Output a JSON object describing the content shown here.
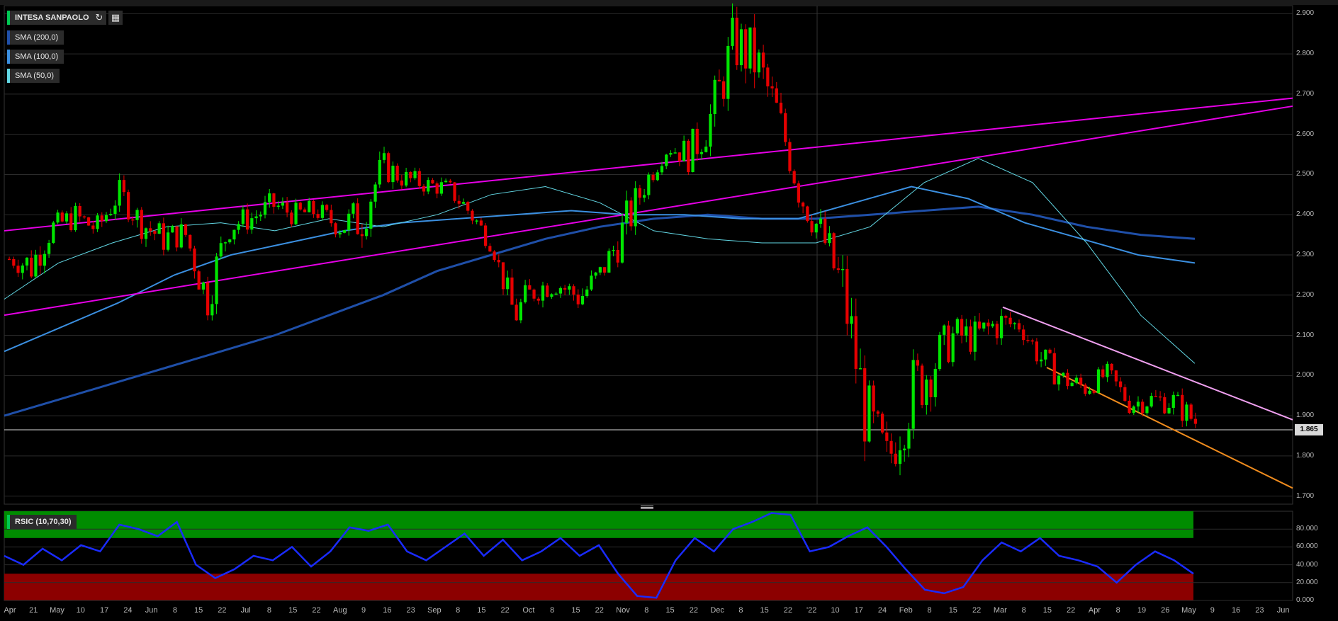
{
  "header": {
    "title": "INTESA SANPAOLO",
    "refresh_icon": "refresh-icon",
    "calendar_icon": "calendar-icon"
  },
  "indicators": [
    {
      "label": "SMA (200,0)",
      "color": "#1f4fa8"
    },
    {
      "label": "SMA (100,0)",
      "color": "#3b8fe0"
    },
    {
      "label": "SMA (50,0)",
      "color": "#62d7e4"
    }
  ],
  "rsi": {
    "label": "RSIC (10,70,30)",
    "yticks": [
      "80.000",
      "60.000",
      "40.000",
      "20.000",
      "0.000"
    ]
  },
  "last_price": "1.865",
  "colors": {
    "up": "#00e600",
    "down": "#e60000",
    "trendline": "#e600e6",
    "channel_upper": "#f0a0f0",
    "channel_lower": "#f08c1e",
    "rsi_line": "#1a2bff",
    "overbought": "#008c00",
    "oversold": "#8c0000"
  },
  "chart_data": {
    "type": "candlestick",
    "title": "INTESA SANPAOLO",
    "ylim": [
      1.68,
      2.92
    ],
    "yticks": [
      "2.900",
      "2.800",
      "2.700",
      "2.600",
      "2.500",
      "2.400",
      "2.300",
      "2.200",
      "2.100",
      "2.000",
      "1.900",
      "1.800",
      "1.700"
    ],
    "xticks": [
      "Apr",
      "21",
      "May",
      "10",
      "17",
      "24",
      "Jun",
      "8",
      "15",
      "22",
      "Jul",
      "8",
      "15",
      "22",
      "Aug",
      "9",
      "16",
      "23",
      "Sep",
      "8",
      "15",
      "22",
      "Oct",
      "8",
      "15",
      "22",
      "Nov",
      "8",
      "15",
      "22",
      "Dec",
      "8",
      "15",
      "22",
      "'22",
      "10",
      "17",
      "24",
      "Feb",
      "8",
      "15",
      "22",
      "Mar",
      "8",
      "15",
      "22",
      "Apr",
      "8",
      "19",
      "26",
      "May",
      "9",
      "16",
      "23",
      "Jun"
    ],
    "price_path": [
      [
        2.27,
        2.31
      ],
      [
        2.22,
        2.33
      ],
      [
        2.34,
        2.4
      ],
      [
        2.36,
        2.43
      ],
      [
        2.33,
        2.4
      ],
      [
        2.42,
        2.49
      ],
      [
        2.34,
        2.42
      ],
      [
        2.3,
        2.38
      ],
      [
        2.32,
        2.39
      ],
      [
        2.13,
        2.25
      ],
      [
        2.33,
        2.42
      ],
      [
        2.36,
        2.42
      ],
      [
        2.39,
        2.46
      ],
      [
        2.37,
        2.43
      ],
      [
        2.38,
        2.44
      ],
      [
        2.34,
        2.4
      ],
      [
        2.32,
        2.46
      ],
      [
        2.48,
        2.56
      ],
      [
        2.46,
        2.52
      ],
      [
        2.45,
        2.5
      ],
      [
        2.44,
        2.49
      ],
      [
        2.37,
        2.44
      ],
      [
        2.3,
        2.34
      ],
      [
        2.1,
        2.2
      ],
      [
        2.18,
        2.26
      ],
      [
        2.2,
        2.25
      ],
      [
        2.15,
        2.24
      ],
      [
        2.23,
        2.29
      ],
      [
        2.3,
        2.43
      ],
      [
        2.45,
        2.52
      ],
      [
        2.55,
        2.58
      ],
      [
        2.5,
        2.6
      ],
      [
        2.58,
        2.72
      ],
      [
        2.75,
        2.91
      ],
      [
        2.7,
        2.86
      ],
      [
        2.6,
        2.7
      ],
      [
        2.4,
        2.5
      ],
      [
        2.3,
        2.4
      ],
      [
        2.1,
        2.3
      ],
      [
        1.8,
        2.0
      ],
      [
        1.72,
        1.85
      ],
      [
        1.85,
        2.05
      ],
      [
        1.95,
        2.1
      ],
      [
        2.05,
        2.15
      ],
      [
        2.05,
        2.14
      ],
      [
        2.08,
        2.18
      ],
      [
        2.1,
        2.15
      ],
      [
        2.0,
        2.08
      ],
      [
        1.96,
        2.02
      ],
      [
        1.94,
        2.0
      ],
      [
        1.98,
        2.03
      ],
      [
        1.9,
        1.96
      ],
      [
        1.91,
        1.97
      ],
      [
        1.9,
        1.97
      ],
      [
        1.85,
        1.92
      ]
    ],
    "sma200": [
      1.9,
      1.94,
      1.98,
      2.02,
      2.06,
      2.1,
      2.15,
      2.2,
      2.26,
      2.3,
      2.34,
      2.37,
      2.39,
      2.4,
      2.39,
      2.39,
      2.4,
      2.41,
      2.42,
      2.4,
      2.37,
      2.35,
      2.34
    ],
    "sma100": [
      2.06,
      2.12,
      2.18,
      2.25,
      2.3,
      2.33,
      2.36,
      2.38,
      2.39,
      2.4,
      2.41,
      2.4,
      2.4,
      2.39,
      2.39,
      2.43,
      2.47,
      2.44,
      2.38,
      2.34,
      2.3,
      2.28
    ],
    "sma50": [
      2.19,
      2.28,
      2.33,
      2.37,
      2.38,
      2.36,
      2.39,
      2.37,
      2.4,
      2.45,
      2.47,
      2.43,
      2.36,
      2.34,
      2.33,
      2.33,
      2.37,
      2.48,
      2.54,
      2.48,
      2.33,
      2.15,
      2.03
    ],
    "trendlines": [
      {
        "name": "",
        "from": [
          "Apr",
          2.36
        ],
        "to": [
          "Jun",
          2.69
        ]
      },
      {
        "name": "",
        "from": [
          "Apr",
          2.15
        ],
        "to": [
          "Jun",
          2.67
        ]
      },
      {
        "name": "",
        "from": [
          "Mar",
          2.17
        ],
        "to": [
          "Jun",
          1.89
        ]
      },
      {
        "name": "",
        "from": [
          "Mar",
          2.02
        ],
        "to": [
          "Jun",
          1.72
        ]
      }
    ],
    "rsi_values": [
      50,
      40,
      58,
      45,
      62,
      55,
      85,
      80,
      72,
      88,
      40,
      25,
      35,
      50,
      45,
      60,
      38,
      55,
      82,
      78,
      85,
      55,
      45,
      60,
      75,
      50,
      68,
      45,
      55,
      70,
      50,
      62,
      30,
      5,
      3,
      45,
      70,
      55,
      80,
      88,
      98,
      96,
      55,
      60,
      72,
      82,
      60,
      35,
      12,
      8,
      15,
      45,
      65,
      55,
      70,
      50,
      45,
      38,
      20,
      40,
      55,
      45,
      30
    ]
  }
}
